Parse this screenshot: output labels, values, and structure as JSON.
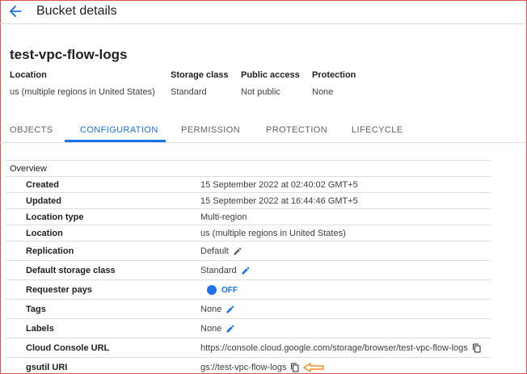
{
  "header": {
    "title": "Bucket details",
    "back_icon": "arrow-left-icon"
  },
  "bucket": {
    "name": "test-vpc-flow-logs"
  },
  "meta": [
    {
      "label": "Location",
      "value": "us (multiple regions in United States)"
    },
    {
      "label": "Storage class",
      "value": "Standard"
    },
    {
      "label": "Public access",
      "value": "Not public"
    },
    {
      "label": "Protection",
      "value": "None"
    }
  ],
  "tabs": [
    {
      "label": "OBJECTS",
      "active": false
    },
    {
      "label": "CONFIGURATION",
      "active": true
    },
    {
      "label": "PERMISSION",
      "active": false
    },
    {
      "label": "PROTECTION",
      "active": false
    },
    {
      "label": "LIFECYCLE",
      "active": false
    }
  ],
  "overview": {
    "heading": "Overview",
    "rows": [
      {
        "label": "Created",
        "value": "15 September 2022 at 02:40:02 GMT+5"
      },
      {
        "label": "Updated",
        "value": "15 September 2022 at 16:44:46 GMT+5"
      },
      {
        "label": "Location type",
        "value": "Multi-region"
      },
      {
        "label": "Location",
        "value": "us (multiple regions in United States)"
      },
      {
        "label": "Replication",
        "value": "Default"
      },
      {
        "label": "Default storage class",
        "value": "Standard"
      },
      {
        "label": "Requester pays",
        "value": "OFF"
      },
      {
        "label": "Tags",
        "value": "None"
      },
      {
        "label": "Labels",
        "value": "None"
      },
      {
        "label": "Cloud Console URL",
        "value": "https://console.cloud.google.com/storage/browser/test-vpc-flow-logs"
      },
      {
        "label": "gsutil URI",
        "value": "gs://test-vpc-flow-logs"
      }
    ]
  },
  "colors": {
    "accent": "#1a73e8",
    "annotation_arrow": "#f08a24",
    "border": "#dadce0"
  }
}
